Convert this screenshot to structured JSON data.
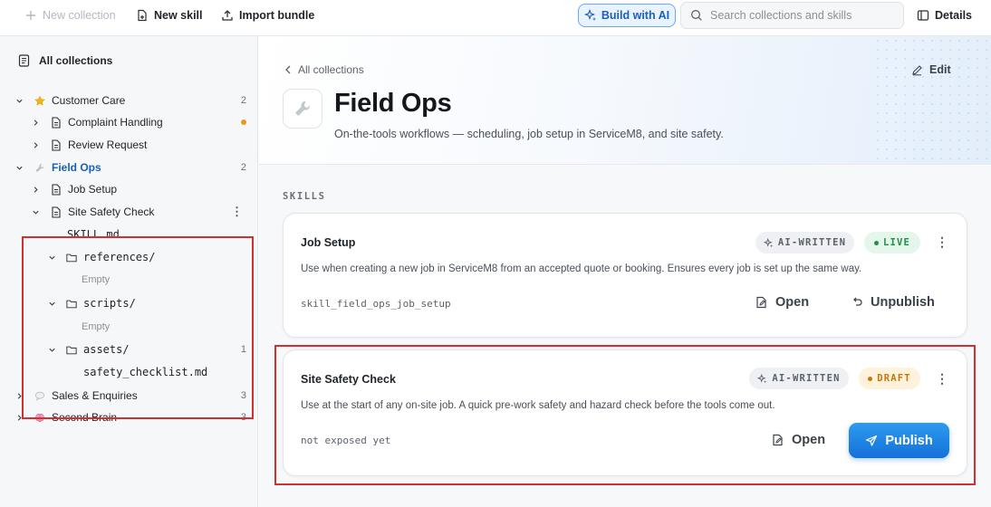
{
  "toolbar": {
    "new_collection": "New collection",
    "new_skill": "New skill",
    "import_bundle": "Import bundle",
    "build_with_ai": "Build with AI",
    "search_placeholder": "Search collections and skills",
    "details": "Details"
  },
  "sidebar": {
    "all_collections": "All collections",
    "tree": {
      "customer_care": {
        "label": "Customer Care",
        "count": "2"
      },
      "complaint_handling": {
        "label": "Complaint Handling"
      },
      "review_request": {
        "label": "Review Request"
      },
      "field_ops": {
        "label": "Field Ops",
        "count": "2"
      },
      "job_setup": {
        "label": "Job Setup"
      },
      "site_safety_check": {
        "label": "Site Safety Check"
      },
      "skill_md": {
        "label": "SKILL.md"
      },
      "references": {
        "label": "references/",
        "empty": "Empty"
      },
      "scripts": {
        "label": "scripts/",
        "empty": "Empty"
      },
      "assets": {
        "label": "assets/",
        "count": "1"
      },
      "safety_checklist": {
        "label": "safety_checklist.md"
      },
      "sales_enquiries": {
        "label": "Sales & Enquiries",
        "count": "3"
      },
      "second_brain": {
        "label": "Second Brain",
        "count": "3"
      }
    }
  },
  "main": {
    "back_label": "All collections",
    "edit_label": "Edit",
    "title": "Field Ops",
    "subtitle": "On-the-tools workflows — scheduling, job setup in ServiceM8, and site safety.",
    "section_label": "SKILLS",
    "skills": [
      {
        "title": "Job Setup",
        "badge_ai": "AI-WRITTEN",
        "status": "LIVE",
        "description": "Use when creating a new job in ServiceM8 from an accepted quote or booking. Ensures every job is set up the same way.",
        "identifier": "skill_field_ops_job_setup",
        "open_label": "Open",
        "secondary_label": "Unpublish"
      },
      {
        "title": "Site Safety Check",
        "badge_ai": "AI-WRITTEN",
        "status": "DRAFT",
        "description": "Use at the start of any on-site job. A quick pre-work safety and hazard check before the tools come out.",
        "identifier": "not exposed yet",
        "open_label": "Open",
        "primary_label": "Publish"
      }
    ]
  },
  "colors": {
    "accent": "#1b5fb8",
    "publish_button": "#1570d8",
    "live": "#1f8f4c",
    "draft": "#c2780a",
    "highlight_box": "#d32f2f"
  },
  "icons": {
    "customer_care": "star-icon",
    "field_ops": "wrench-icon",
    "sales_enquiries": "speech-bubble-icon",
    "second_brain": "brain-icon"
  }
}
